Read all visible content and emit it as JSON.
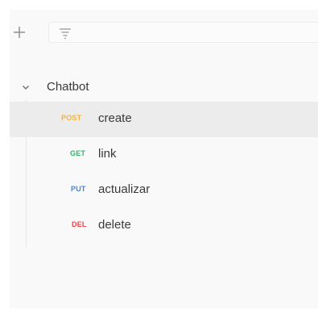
{
  "toolbar": {
    "add_icon": "plus-icon",
    "filter_icon": "filter-icon",
    "filter_placeholder": ""
  },
  "collection": {
    "name": "Chatbot",
    "expanded": true,
    "chevron_icon": "chevron-down-icon"
  },
  "requests": [
    {
      "method": "POST",
      "name": "create",
      "method_color": "#f5b62a",
      "selected": true
    },
    {
      "method": "GET",
      "name": "link",
      "method_color": "#2fb36b",
      "selected": false
    },
    {
      "method": "PUT",
      "name": "actualizar",
      "method_color": "#3a86f0",
      "selected": false
    },
    {
      "method": "DEL",
      "name": "delete",
      "method_color": "#e5484d",
      "selected": false
    }
  ],
  "colors": {
    "panel_bg": "#f9f9f9",
    "selected_bg": "#ececec",
    "text": "#3a3a3a",
    "icon": "#8a8a8a"
  }
}
